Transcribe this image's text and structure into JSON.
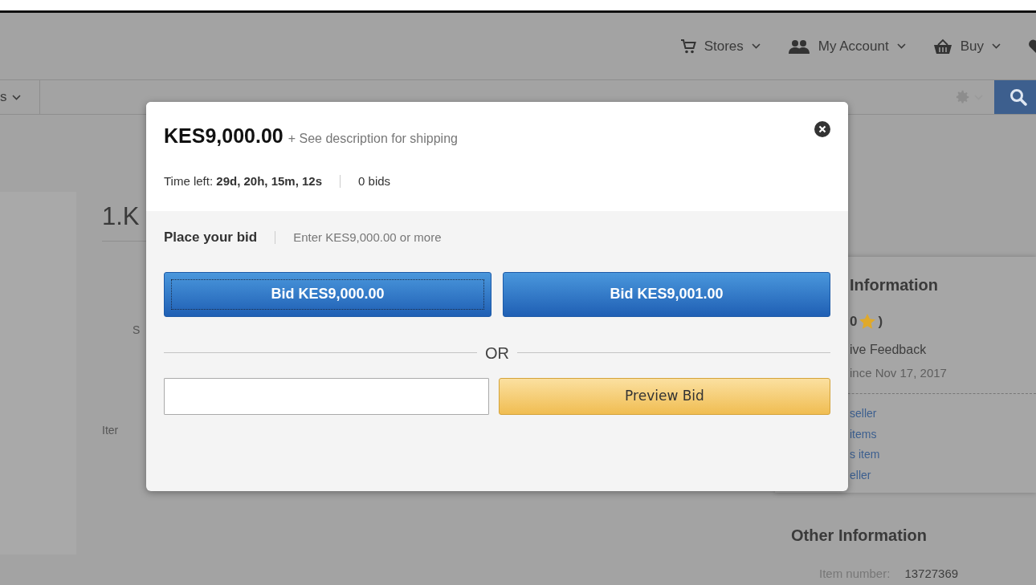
{
  "header": {
    "nav": [
      {
        "label": "Stores"
      },
      {
        "label": "My Account"
      },
      {
        "label": "Buy"
      }
    ]
  },
  "search_bar": {
    "category": "s"
  },
  "page": {
    "title": "1.K",
    "labels": [
      "S",
      "Iter"
    ]
  },
  "seller_panel": {
    "title": "Information",
    "rating_start": "0",
    "rating_end": ")",
    "feedback": "ive Feedback",
    "member_since": "ince Nov 17, 2017",
    "links": [
      "seller",
      "items",
      "s item",
      "eller"
    ]
  },
  "other_info": {
    "title": "Other Information",
    "item_number_label": "Item number:",
    "item_number": "13727369"
  },
  "modal": {
    "price": "KES9,000.00",
    "shipping": "+ See description for shipping",
    "time_left": "Time left: **29d, 20h, 15m, 12s**",
    "bids": "0 bids",
    "place_bid": "Place your bid",
    "hint": "Enter KES9,000.00 or more",
    "bid_buttons": [
      {
        "label": "Bid KES9,000.00",
        "focused": true
      },
      {
        "label": "Bid KES9,001.00",
        "focused": false
      }
    ],
    "or": "OR",
    "preview_button": "Preview Bid"
  }
}
